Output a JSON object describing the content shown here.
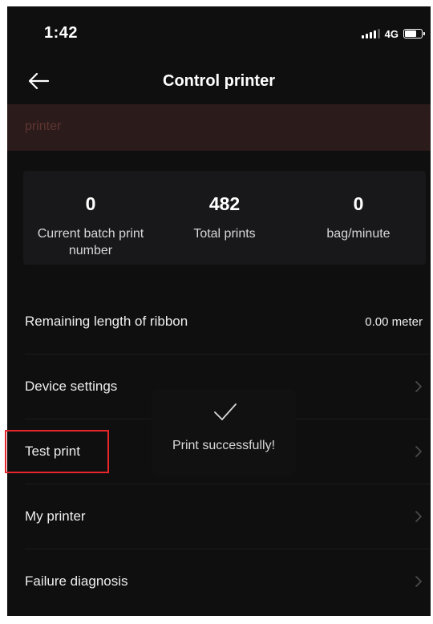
{
  "status_bar": {
    "time": "1:42",
    "network": "4G"
  },
  "header": {
    "title": "Control printer"
  },
  "printer_bar": {
    "label": "printer"
  },
  "stats": [
    {
      "value": "0",
      "label": "Current batch print number"
    },
    {
      "value": "482",
      "label": "Total prints"
    },
    {
      "value": "0",
      "label": "bag/minute"
    }
  ],
  "ribbon": {
    "label": "Remaining length of ribbon",
    "value": "0.00 meter"
  },
  "menu": [
    {
      "label": "Device settings"
    },
    {
      "label": "Test print"
    },
    {
      "label": "My printer"
    },
    {
      "label": "Failure diagnosis"
    }
  ],
  "toast": {
    "message": "Print successfully!"
  },
  "colors": {
    "background": "#0f0f10",
    "highlight": "#e6262a",
    "printer_strip": "#2c1b1b"
  },
  "icons": [
    "arrow-left",
    "checkmark",
    "chevron-right"
  ]
}
